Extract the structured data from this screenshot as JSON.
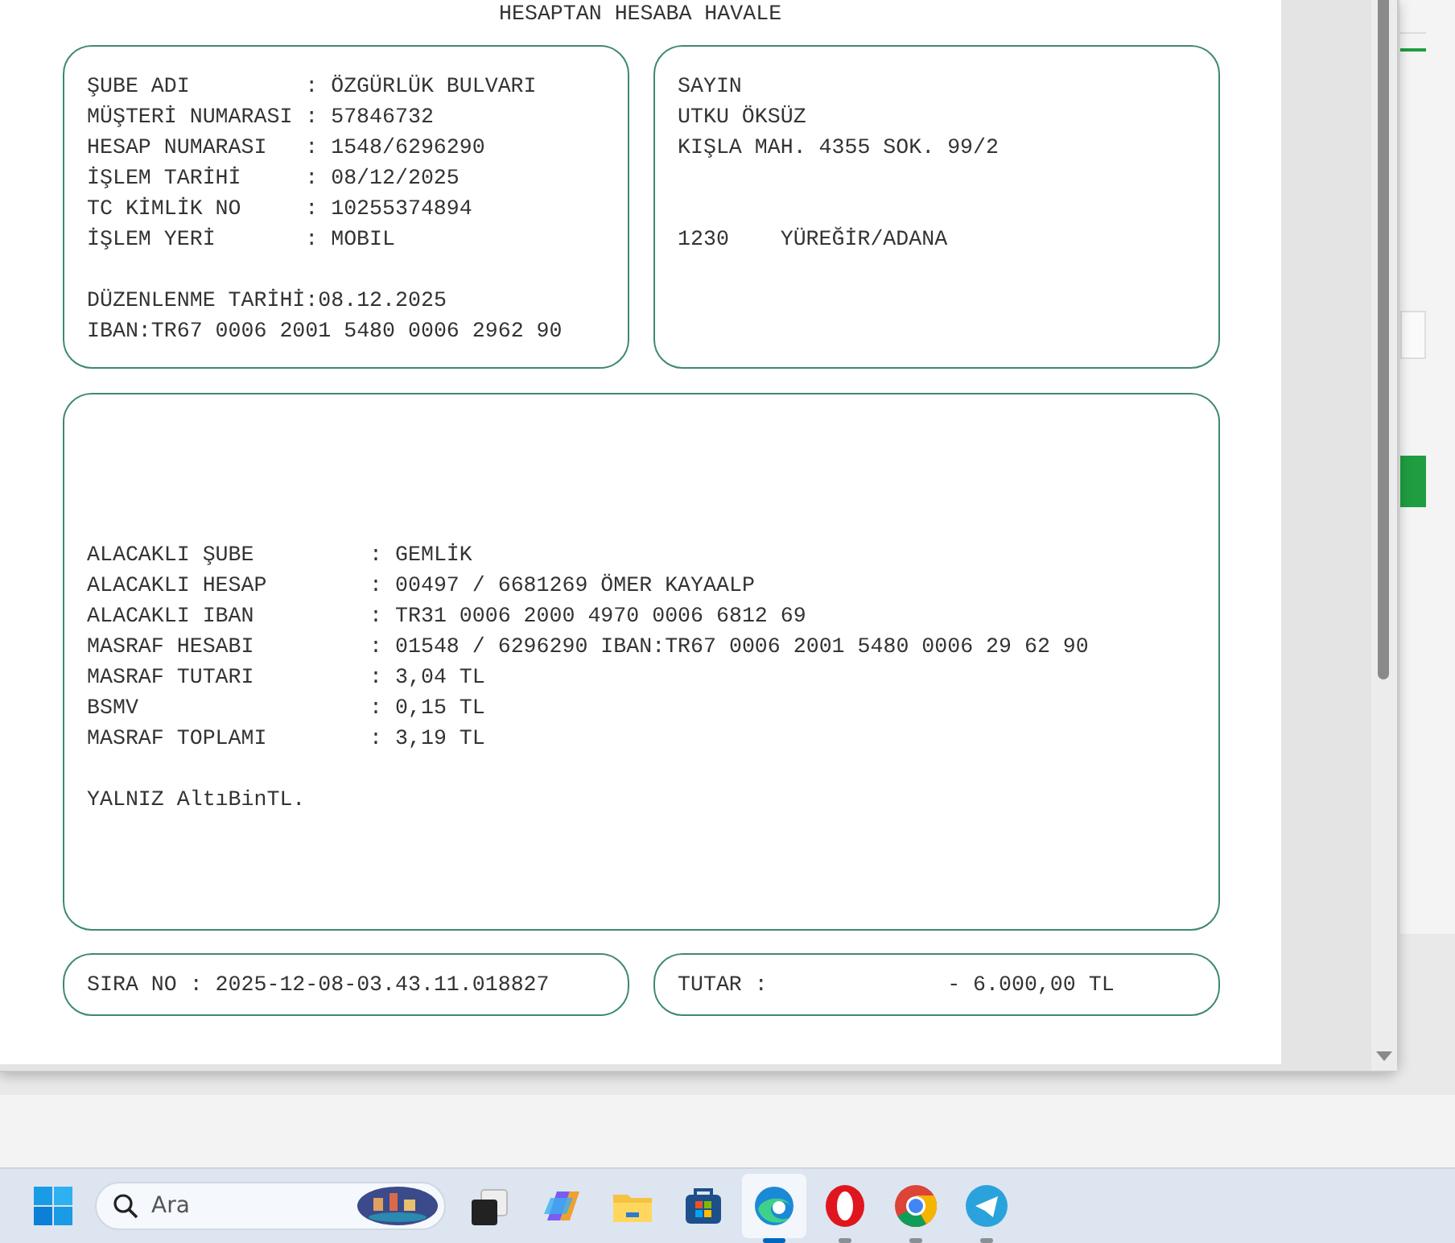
{
  "document": {
    "title": "HESAPTAN HESABA HAVALE",
    "sender_box": {
      "fields": [
        {
          "label": "ŞUBE ADI",
          "value": ": ÖZGÜRLÜK BULVARI"
        },
        {
          "label": "MÜŞTERİ NUMARASI",
          "value": ": 57846732"
        },
        {
          "label": "HESAP NUMARASI",
          "value": ": 1548/6296290"
        },
        {
          "label": "İŞLEM TARİHİ",
          "value": ": 08/12/2025"
        },
        {
          "label": "TC KİMLİK NO",
          "value": ": 10255374894"
        },
        {
          "label": "İŞLEM YERİ",
          "value": ": MOBIL"
        }
      ],
      "lines": [
        "DÜZENLENME TARİHİ:08.12.2025",
        "IBAN:TR67 0006 2001 5480 0006 2962 90"
      ]
    },
    "address_box": {
      "lines": [
        "SAYIN",
        "UTKU ÖKSÜZ",
        "KIŞLA MAH. 4355 SOK. 99/2"
      ],
      "postal_line": "1230    YÜREĞİR/ADANA"
    },
    "detail_box": {
      "fields": [
        {
          "label": "ALACAKLI ŞUBE",
          "value": ": GEMLİK"
        },
        {
          "label": "ALACAKLI HESAP",
          "value": ": 00497 / 6681269 ÖMER KAYAALP"
        },
        {
          "label": "ALACAKLI IBAN",
          "value": ": TR31 0006 2000 4970 0006 6812 69"
        },
        {
          "label": "MASRAF HESABI",
          "value": ": 01548 / 6296290 IBAN:TR67 0006 2001 5480 0006 29 62 90"
        },
        {
          "label": "MASRAF TUTARI",
          "value": ": 3,04 TL"
        },
        {
          "label": "BSMV",
          "value": ": 0,15 TL"
        },
        {
          "label": "MASRAF TOPLAMI",
          "value": ": 3,19 TL"
        }
      ],
      "note": "YALNIZ AltıBinTL."
    },
    "sequence": "SIRA NO : 2025-12-08-03.43.11.018827",
    "amount_label": "TUTAR :",
    "amount": "- 6.000,00 TL"
  },
  "taskbar": {
    "search_placeholder": "Ara",
    "apps": [
      {
        "kind": "taskview",
        "running": false,
        "active": false
      },
      {
        "kind": "copilot",
        "running": false,
        "active": false
      },
      {
        "kind": "folder",
        "running": false,
        "active": false
      },
      {
        "kind": "store",
        "running": false,
        "active": false
      },
      {
        "kind": "edge",
        "running": true,
        "active": true
      },
      {
        "kind": "opera",
        "running": true,
        "active": false
      },
      {
        "kind": "chrome",
        "running": true,
        "active": false
      },
      {
        "kind": "telegram",
        "running": true,
        "active": false
      }
    ]
  }
}
